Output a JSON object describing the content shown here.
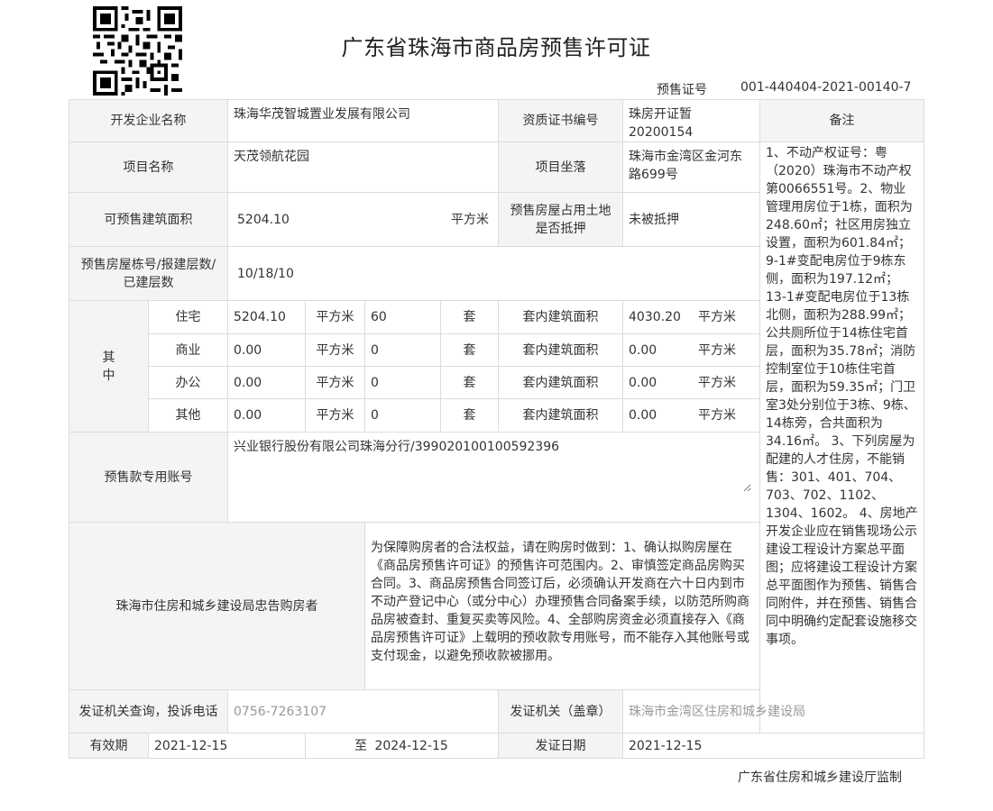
{
  "title": "广东省珠海市商品房预售许可证",
  "cert_no": {
    "label": "预售证号",
    "value": "001-440404-2021-00140-7"
  },
  "table": {
    "developer": {
      "label": "开发企业名称",
      "value": "珠海华茂智城置业发展有限公司"
    },
    "qualification": {
      "label": "资质证书编号",
      "value": "珠房开证暂20200154"
    },
    "remark": {
      "label": "备注",
      "text": "1、不动产权证号：粤（2020）珠海市不动产权第0066551号。2、物业管理用房位于1栋，面积为248.60㎡；社区用房独立设置，面积为601.84㎡； 9-1#变配电房位于9栋东侧，面积为197.12㎡；13-1#变配电房位于13栋北侧，面积为288.99㎡；公共厕所位于14栋住宅首层，面积为35.78㎡；消防控制室位于10栋住宅首层，面积为59.35㎡；门卫室3处分别位于3栋、9栋、14栋旁，合共面积为34.16㎡。 3、下列房屋为配建的人才住房，不能销售：301、401、704、703、702、1102、1304、1602。 4、房地产开发企业应在销售现场公示建设工程设计方案总平面图；应将建设工程设计方案总平面图作为预售、销售合同附件，并在预售、销售合同中明确约定配套设施移交事项。"
    },
    "project_name": {
      "label": "项目名称",
      "value": "天茂领航花园"
    },
    "project_location": {
      "label": "项目坐落",
      "value": "珠海市金湾区金河东路699号"
    },
    "presale_area": {
      "label": "可预售建筑面积",
      "value": "5204.10",
      "unit": "平方米"
    },
    "mortgage": {
      "label": "预售房屋占用土地是否抵押",
      "value": "未被抵押"
    },
    "buildings": {
      "label": "预售房屋栋号/报建层数/已建层数",
      "value": "10/18/10"
    },
    "breakdown": {
      "label": "其中",
      "area_unit": "平方米",
      "set_unit": "套",
      "inner_label": "套内建筑面积",
      "rows": [
        {
          "type": "住宅",
          "area": "5204.10",
          "sets": "60",
          "inner_area": "4030.20"
        },
        {
          "type": "商业",
          "area": "0.00",
          "sets": "0",
          "inner_area": "0.00"
        },
        {
          "type": "办公",
          "area": "0.00",
          "sets": "0",
          "inner_area": "0.00"
        },
        {
          "type": "其他",
          "area": "0.00",
          "sets": "0",
          "inner_area": "0.00"
        }
      ]
    },
    "account": {
      "label": "预售款专用账号",
      "value": "兴业银行股份有限公司珠海分行/399020100100592396"
    },
    "notice": {
      "label": "珠海市住房和城乡建设局忠告购房者",
      "text": "为保障购房者的合法权益，请在购房时做到：1、确认拟购房屋在《商品房预售许可证》的预售许可范围内。2、审慎签定商品房购买合同。3、商品房预售合同签订后，必须确认开发商在六十日内到市不动产登记中心（或分中心）办理预售合同备案手续，以防范所购商品房被查封、重复买卖等风险。4、全部购房资金必须直接存入《商品房预售许可证》上载明的预收款专用账号，而不能存入其他账号或支付现金，以避免预收款被挪用。"
    },
    "complaint": {
      "label": "发证机关查询，投诉电话",
      "value": "0756-7263107"
    },
    "authority": {
      "label": "发证机关（盖章）",
      "value": "珠海市金湾区住房和城乡建设局"
    },
    "validity": {
      "label": "有效期",
      "from": "2021-12-15",
      "to_label": "至",
      "to": "2024-12-15"
    },
    "issue_date": {
      "label": "发证日期",
      "value": "2021-12-15"
    }
  },
  "footer": "广东省住房和城乡建设厅监制"
}
